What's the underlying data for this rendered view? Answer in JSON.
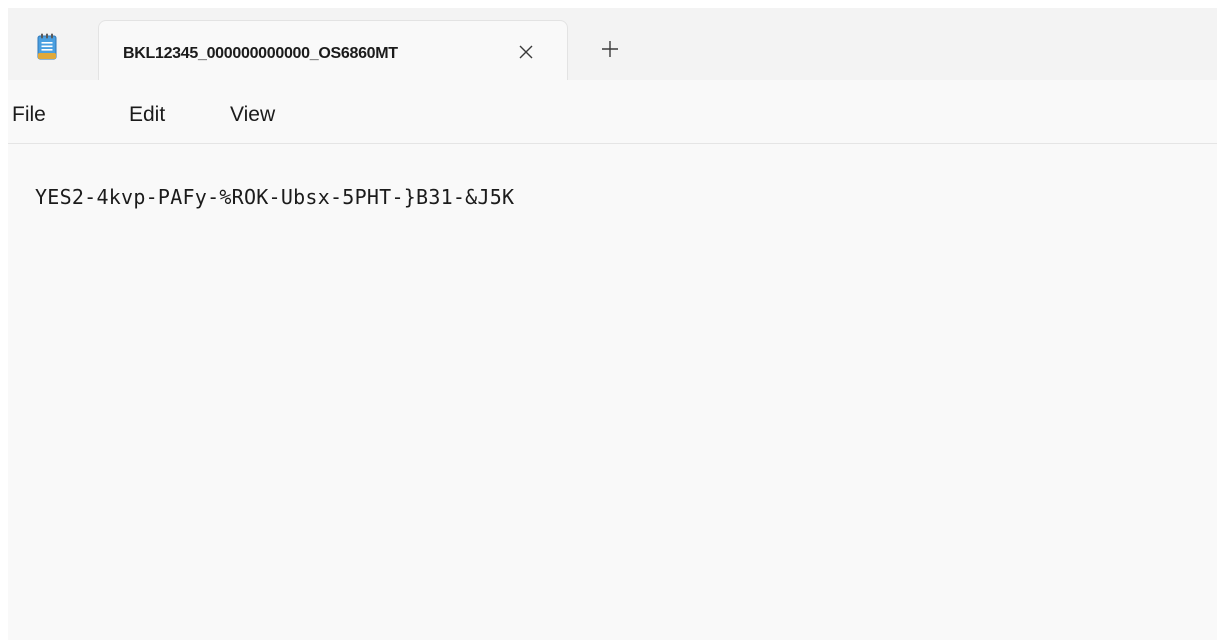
{
  "window": {
    "app_icon": "notepad-icon",
    "tab": {
      "title": "BKL12345_000000000000_OS6860MT",
      "close_icon": "close-icon"
    },
    "new_tab_icon": "plus-icon"
  },
  "menu": {
    "items": [
      {
        "label": "File"
      },
      {
        "label": "Edit"
      },
      {
        "label": "View"
      }
    ]
  },
  "editor": {
    "content": "YES2-4kvp-PAFy-%ROK-Ubsx-5PHT-}B31-&J5K"
  },
  "colors": {
    "tabbar_background": "#f3f3f3",
    "editor_background": "#f9f9f9",
    "text": "#1b1b1b",
    "notepad_icon_blue": "#4a9fe0"
  }
}
